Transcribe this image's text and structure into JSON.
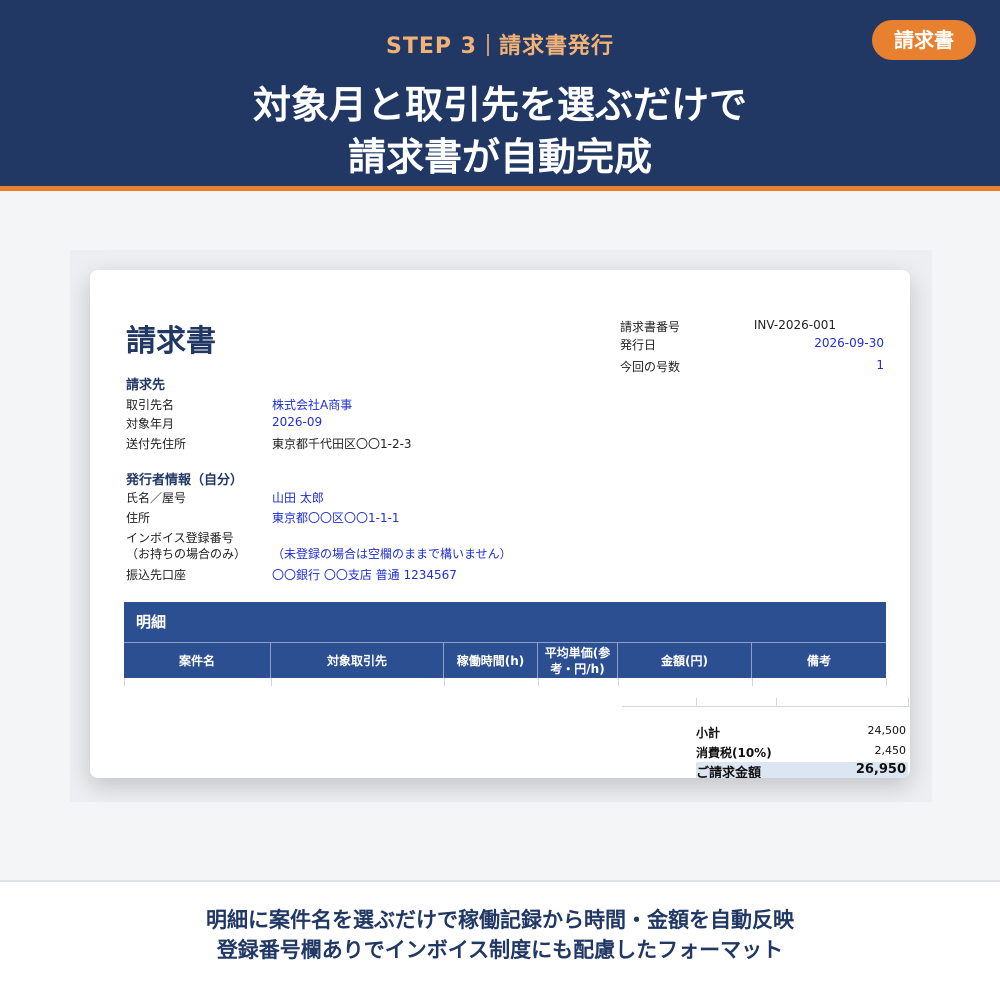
{
  "header": {
    "step": "STEP 3",
    "step_title": "請求書発行",
    "headline_line1": "対象月と取引先を選ぶだけで",
    "headline_line2": "請求書が自動完成",
    "tag": "請求書"
  },
  "invoice": {
    "title": "請求書",
    "meta": [
      {
        "label": "請求書番号",
        "value": "INV-2026-001"
      },
      {
        "label": "発行日",
        "value": "2026-09-30"
      },
      {
        "label": "今回の号数",
        "value": "1"
      }
    ],
    "billing_section": "請求先",
    "billing": [
      {
        "label": "取引先名",
        "value": "株式会社A商事"
      },
      {
        "label": "対象年月",
        "value": "2026-09"
      },
      {
        "label": "送付先住所",
        "value": "東京都千代田区〇〇1-2-3"
      }
    ],
    "issuer_section": "発行者情報（自分）",
    "issuer": [
      {
        "label": "氏名／屋号",
        "value": "山田 太郎"
      },
      {
        "label": "住所",
        "value": "東京都〇〇区〇〇1-1-1"
      },
      {
        "label": "インボイス登録番号",
        "value": ""
      },
      {
        "label": "（お持ちの場合のみ）",
        "value": "（未登録の場合は空欄のままで構いません）"
      },
      {
        "label": "振込先口座",
        "value": "〇〇銀行 〇〇支店 普通 1234567"
      }
    ],
    "detail_title": "明細",
    "columns": [
      "案件名",
      "対象取引先",
      "稼働時間(h)",
      "平均単価(参考・円/h)",
      "金額(円)",
      "備考"
    ],
    "summary": [
      {
        "label": "小計",
        "value": "24,500"
      },
      {
        "label": "消費税(10%)",
        "value": "2,450"
      },
      {
        "label": "ご請求金額",
        "value": "26,950"
      }
    ]
  },
  "footer": {
    "line1": "明細に案件名を選ぶだけで稼働記録から時間・金額を自動反映",
    "line2": "登録番号欄ありでインボイス制度にも配慮したフォーマット"
  },
  "colors": {
    "navy": "#213865",
    "orange": "#e8812f",
    "table_header": "#2c4f91",
    "value_blue": "#1f2fd1"
  }
}
